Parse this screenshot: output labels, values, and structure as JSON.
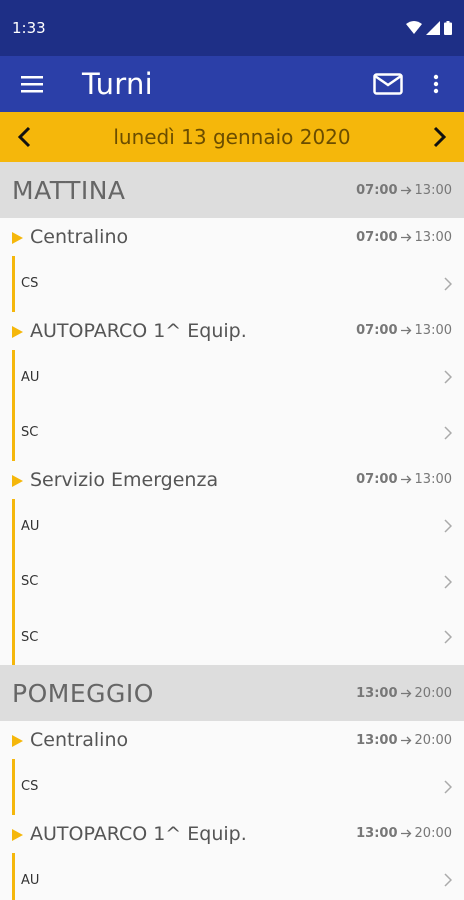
{
  "status": {
    "time": "1:33"
  },
  "appbar": {
    "title": "Turni"
  },
  "datebar": {
    "date": "lunedì 13 gennaio 2020"
  },
  "periods": [
    {
      "name": "MATTINA",
      "start": "07:00",
      "end": "13:00",
      "services": [
        {
          "name": "Centralino",
          "start": "07:00",
          "end": "13:00",
          "rows": [
            "CS"
          ]
        },
        {
          "name": "AUTOPARCO 1^ Equip.",
          "start": "07:00",
          "end": "13:00",
          "rows": [
            "AU",
            "SC"
          ]
        },
        {
          "name": "Servizio Emergenza",
          "start": "07:00",
          "end": "13:00",
          "rows": [
            "AU",
            "SC",
            "SC"
          ]
        }
      ]
    },
    {
      "name": "POMEGGIO",
      "start": "13:00",
      "end": "20:00",
      "services": [
        {
          "name": "Centralino",
          "start": "13:00",
          "end": "20:00",
          "rows": [
            "CS"
          ]
        },
        {
          "name": "AUTOPARCO 1^ Equip.",
          "start": "13:00",
          "end": "20:00",
          "rows": [
            "AU"
          ]
        }
      ]
    }
  ],
  "colors": {
    "statusbar": "#1e2f86",
    "appbar": "#2b3fa8",
    "accent": "#f5b70b"
  },
  "icons": {
    "menu": "menu-icon",
    "mail": "mail-icon",
    "more": "more-vert-icon",
    "prev": "chevron-left-icon",
    "next": "chevron-right-icon",
    "row": "chevron-right-icon"
  }
}
